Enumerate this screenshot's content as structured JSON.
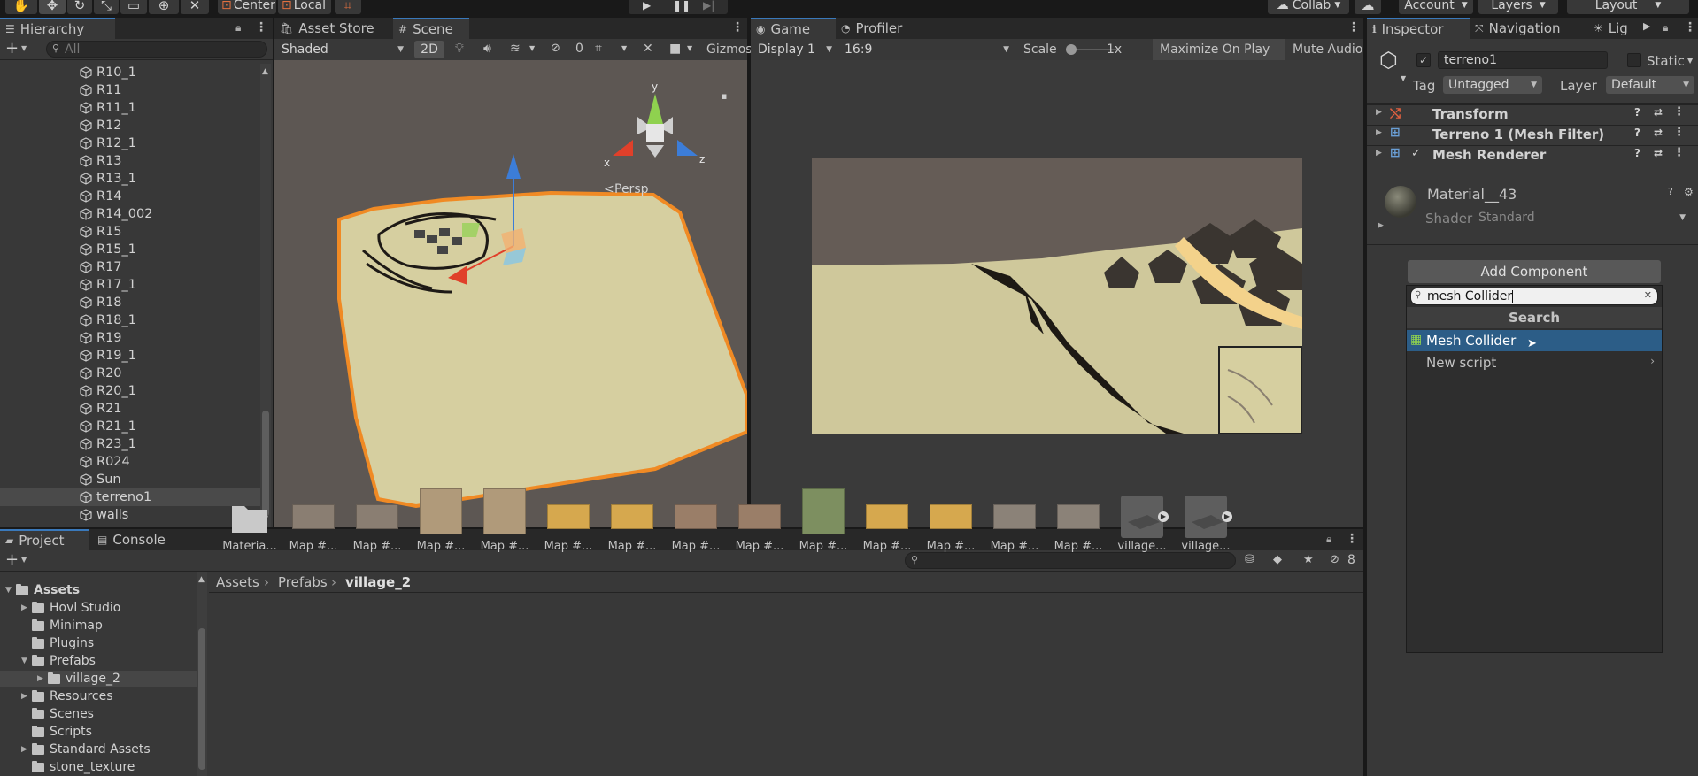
{
  "toolbar": {
    "pivot": "Center",
    "space": "Local",
    "account": "Account",
    "layers": "Layers",
    "layout": "Layout",
    "collab": "Collab"
  },
  "hierarchy": {
    "tab": "Hierarchy",
    "search_placeholder": "All",
    "items": [
      "R10_1",
      "R11",
      "R11_1",
      "R12",
      "R12_1",
      "R13",
      "R13_1",
      "R14",
      "R14_002",
      "R15",
      "R15_1",
      "R17",
      "R17_1",
      "R18",
      "R18_1",
      "R19",
      "R19_1",
      "R20",
      "R20_1",
      "R21",
      "R21_1",
      "R23_1",
      "R024",
      "Sun",
      "terreno1",
      "walls"
    ],
    "selected": "terreno1"
  },
  "scene": {
    "tabs": [
      "Asset Store",
      "Scene"
    ],
    "shading": "Shaded",
    "mode_2d": "2D",
    "fx_count": "0",
    "gizmos": "Gizmos",
    "persp": "Persp",
    "axis_labels": {
      "x": "x",
      "y": "y",
      "z": "z"
    }
  },
  "game": {
    "tabs": [
      "Game",
      "Profiler"
    ],
    "display": "Display 1",
    "aspect": "16:9",
    "scale_label": "Scale",
    "scale_value": "1x",
    "maximize": "Maximize On Play",
    "mute": "Mute Audio"
  },
  "inspector": {
    "tabs": [
      "Inspector",
      "Navigation",
      "Lig"
    ],
    "object_name": "terreno1",
    "static_label": "Static",
    "tag_label": "Tag",
    "tag_value": "Untagged",
    "layer_label": "Layer",
    "layer_value": "Default",
    "components": [
      "Transform",
      "Terreno 1 (Mesh Filter)",
      "Mesh Renderer"
    ],
    "material_name": "Material__43",
    "shader_label": "Shader",
    "shader_value": "Standard",
    "add_component": "Add Component",
    "search_value": "mesh Collider",
    "search_header": "Search",
    "results": [
      "Mesh Collider",
      "New script"
    ]
  },
  "project": {
    "tabs": [
      "Project",
      "Console"
    ],
    "hidden_count": "8",
    "tree": [
      {
        "label": "Assets",
        "level": 0,
        "expanded": true
      },
      {
        "label": "Hovl Studio",
        "level": 1,
        "expanded": false
      },
      {
        "label": "Minimap",
        "level": 1,
        "expanded": null
      },
      {
        "label": "Plugins",
        "level": 1,
        "expanded": null
      },
      {
        "label": "Prefabs",
        "level": 1,
        "expanded": true
      },
      {
        "label": "village_2",
        "level": 2,
        "expanded": false
      },
      {
        "label": "Resources",
        "level": 1,
        "expanded": false
      },
      {
        "label": "Scenes",
        "level": 1,
        "expanded": null
      },
      {
        "label": "Scripts",
        "level": 1,
        "expanded": null
      },
      {
        "label": "Standard Assets",
        "level": 1,
        "expanded": false
      },
      {
        "label": "stone_texture",
        "level": 1,
        "expanded": null
      }
    ],
    "breadcrumb": [
      "Assets",
      "Prefabs",
      "village_2"
    ],
    "assets": [
      "Materia...",
      "Map #...",
      "Map #...",
      "Map #...",
      "Map #...",
      "Map #...",
      "Map #...",
      "Map #...",
      "Map #...",
      "Map #...",
      "Map #...",
      "Map #...",
      "Map #...",
      "Map #...",
      "village...",
      "village..."
    ]
  },
  "colors": {
    "accent": "#3a79bb",
    "selection": "#2c5d87",
    "terrain": "#d6cfa0",
    "outline": "#f08a24",
    "sky": "#5d5753"
  }
}
